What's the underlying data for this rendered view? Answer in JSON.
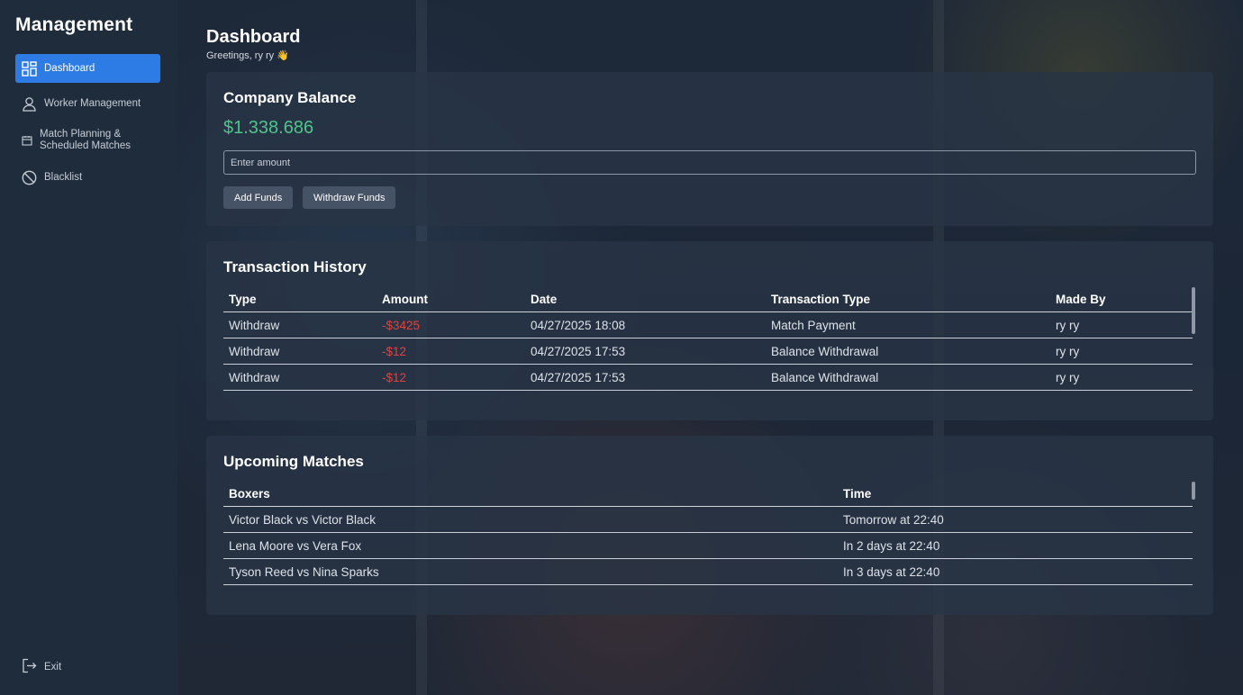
{
  "app": {
    "brand": "Management"
  },
  "sidebar": {
    "items": [
      {
        "label": "Dashboard",
        "icon": "dashboard-grid-icon",
        "active": true
      },
      {
        "label": "Worker Management",
        "icon": "user-icon",
        "active": false
      },
      {
        "label": "Match Planning &\nScheduled Matches",
        "icon": "calendar-icon",
        "active": false
      },
      {
        "label": "Blacklist",
        "icon": "block-icon",
        "active": false
      }
    ],
    "exit_label": "Exit"
  },
  "header": {
    "title": "Dashboard",
    "greeting": "Greetings, ry ry 👋"
  },
  "balance_card": {
    "title": "Company Balance",
    "amount": "$1.338.686",
    "input_placeholder": "Enter amount",
    "add_label": "Add Funds",
    "withdraw_label": "Withdraw Funds"
  },
  "transactions": {
    "title": "Transaction History",
    "columns": [
      "Type",
      "Amount",
      "Date",
      "Transaction Type",
      "Made By"
    ],
    "rows": [
      {
        "type": "Withdraw",
        "amount": "-$3425",
        "date": "04/27/2025 18:08",
        "transaction_type": "Match Payment",
        "made_by": "ry ry"
      },
      {
        "type": "Withdraw",
        "amount": "-$12",
        "date": "04/27/2025 17:53",
        "transaction_type": "Balance Withdrawal",
        "made_by": "ry ry"
      },
      {
        "type": "Withdraw",
        "amount": "-$12",
        "date": "04/27/2025 17:53",
        "transaction_type": "Balance Withdrawal",
        "made_by": "ry ry"
      }
    ]
  },
  "matches": {
    "title": "Upcoming Matches",
    "columns": [
      "Boxers",
      "Time"
    ],
    "rows": [
      {
        "boxers": "Victor Black vs Victor Black",
        "time": "Tomorrow at 22:40"
      },
      {
        "boxers": "Lena Moore vs Vera Fox",
        "time": "In 2 days at 22:40"
      },
      {
        "boxers": "Tyson Reed vs Nina Sparks",
        "time": "In 3 days at 22:40"
      }
    ]
  },
  "colors": {
    "accent": "#2d7be5",
    "balance_green": "#4fc48a",
    "negative_red": "#e0433f"
  }
}
